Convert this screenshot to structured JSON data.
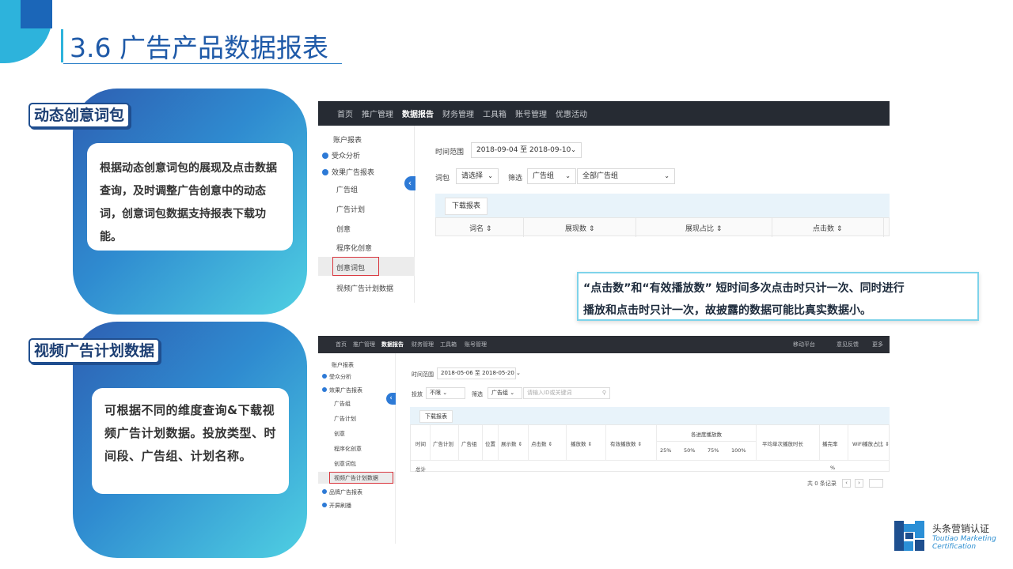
{
  "slide": {
    "title": "3.6 广告产品数据报表"
  },
  "section1": {
    "tag": "动态创意词包",
    "note": "根据动态创意词包的展现及点击数据查询，及时调整广告创意中的动态词，创意词包数据支持报表下载功能。"
  },
  "section2": {
    "tag": "视频广告计划数据",
    "note": "可根据不同的维度查询&下载视频广告计划数据。投放类型、时间段、广告组、计划名称。"
  },
  "callout": {
    "line1": "“点击数”和“有效播放数” 短时间多次点击时只计一次、同时进行",
    "line2": "播放和点击时只计一次，故披露的数据可能比真实数据小。"
  },
  "shot1": {
    "nav": [
      "首页",
      "推广管理",
      "数据报告",
      "财务管理",
      "工具箱",
      "账号管理",
      "优惠活动"
    ],
    "nav_active_index": 2,
    "sidebar": {
      "account_report": "账户报表",
      "audience": "受众分析",
      "effect": "效果广告报表",
      "items": [
        "广告组",
        "广告计划",
        "创意",
        "程序化创意",
        "创意词包",
        "视频广告计划数据"
      ],
      "selected": "创意词包"
    },
    "filters": {
      "time_label": "时间范围",
      "time_value": "2018-09-04 至 2018-09-10",
      "pack_label": "词包",
      "pack_value": "请选择",
      "filter_label": "筛选",
      "filter_value": "广告组",
      "filter_value2": "全部广告组"
    },
    "download_btn": "下载报表",
    "columns": [
      "词名 ⇕",
      "展现数 ⇕",
      "展现占比 ⇕",
      "点击数 ⇕"
    ]
  },
  "shot2": {
    "nav": [
      "首页",
      "推广管理",
      "数据报告",
      "财务管理",
      "工具箱",
      "账号管理"
    ],
    "nav_active_index": 2,
    "nav_right": [
      "移动平台",
      "意见反馈",
      "更多"
    ],
    "sidebar": {
      "account_report": "账户报表",
      "audience": "受众分析",
      "effect": "效果广告报表",
      "items": [
        "广告组",
        "广告计划",
        "创意",
        "程序化创意",
        "创意词包",
        "视频广告计划数据"
      ],
      "selected": "视频广告计划数据",
      "brand": "品牌广告报表",
      "splash": "开屏刷播"
    },
    "filters": {
      "time_label": "时间范围",
      "time_value": "2018-05-06 至 2018-05-20",
      "type_label": "投放",
      "type_value": "不限",
      "filter_label": "筛选",
      "filter_value": "广告组",
      "search_placeholder": "请输入ID或关键词"
    },
    "download_btn": "下载报表",
    "columns": [
      "时间",
      "广告计划",
      "广告组",
      "位置",
      "展示数 ⇕",
      "点击数 ⇕",
      "播放数 ⇕",
      "有效播放数 ⇕",
      "各进度播放数",
      "平均单次播放时长",
      "播完率",
      "WiFi播放占比 ⇕"
    ],
    "progress_cols": [
      "25%",
      "50%",
      "75%",
      "100%"
    ],
    "total_label": "总计",
    "percent_sign": "%",
    "pager": "共 0 条记录"
  },
  "brand": {
    "cn": "头条营销认证",
    "en1": "Toutiao Marketing",
    "en2": "Certification"
  },
  "colors": {
    "title_blue": "#1f5aa8",
    "accent_cyan": "#2db3dc",
    "nav_dark": "#262b33",
    "highlight_red": "#d9363e"
  }
}
